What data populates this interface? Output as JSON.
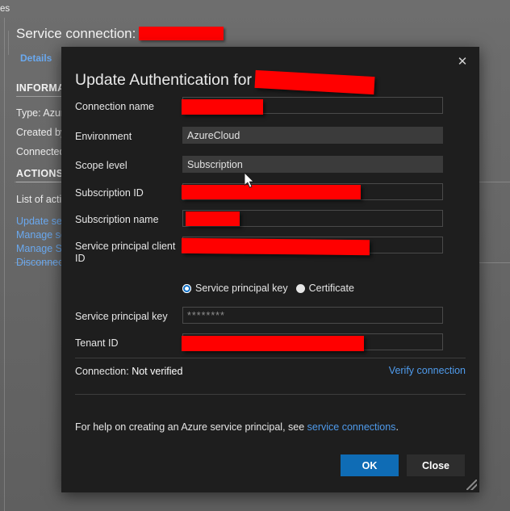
{
  "background": {
    "top_crumb": "es",
    "page_title_prefix": "Service connection:",
    "page_title_redacted": true,
    "tab_label": "Details",
    "sections": {
      "information": "INFORMATION",
      "actions": "ACTIONS"
    },
    "info_lines": [
      "Type: Azure",
      "Created by",
      "Connected"
    ],
    "actions_intro": "List of actio",
    "action_links": [
      "Update ser",
      "Manage ser",
      "Manage Se",
      "Disconnect"
    ]
  },
  "dialog": {
    "title_prefix": "Update Authentication for",
    "title_redacted": true,
    "close_icon": "close-icon",
    "fields": [
      {
        "label": "Connection name",
        "value": "",
        "style": "outlined",
        "redacted": true
      },
      {
        "label": "Environment",
        "value": "AzureCloud",
        "style": "filled",
        "redacted": false
      },
      {
        "label": "Scope level",
        "value": "Subscription",
        "style": "filled",
        "redacted": false
      },
      {
        "label": "Subscription ID",
        "value": "",
        "style": "outlined",
        "redacted": true
      },
      {
        "label": "Subscription name",
        "value": "",
        "style": "outlined",
        "redacted": true
      },
      {
        "label": "Service principal client ID",
        "value": "",
        "style": "outlined",
        "redacted": true
      }
    ],
    "auth_type": {
      "selected": "Service principal key",
      "options": [
        "Service principal key",
        "Certificate"
      ]
    },
    "secret_fields": [
      {
        "label": "Service principal key",
        "value": "********",
        "style": "outlined",
        "redacted": false
      },
      {
        "label": "Tenant ID",
        "value": "",
        "style": "outlined",
        "redacted": true
      }
    ],
    "status": {
      "label": "Connection:",
      "value": "Not verified",
      "verify_link": "Verify connection"
    },
    "help": {
      "text_before": "For help on creating an Azure service principal, see ",
      "link": "service connections",
      "text_after": "."
    },
    "buttons": {
      "ok": "OK",
      "close": "Close"
    }
  },
  "colors": {
    "accent_blue": "#0f6cb5",
    "link_blue": "#4f9bec",
    "redaction_red": "#ff0000",
    "dialog_bg": "#1e1e1e",
    "page_bg": "#6b6b6b"
  }
}
